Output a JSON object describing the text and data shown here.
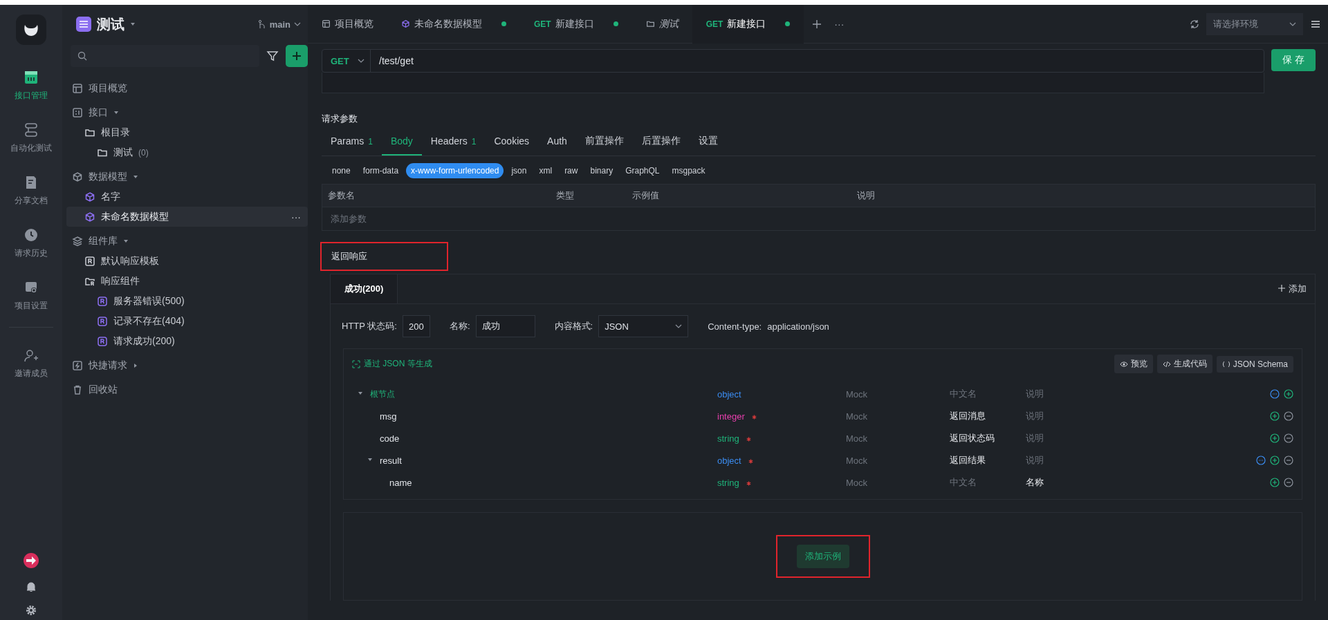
{
  "rail": {
    "items": [
      {
        "label": "接口管理",
        "kind": "api",
        "selected": true
      },
      {
        "label": "自动化测试",
        "kind": "auto",
        "selected": false
      },
      {
        "label": "分享文档",
        "kind": "doc",
        "selected": false
      },
      {
        "label": "请求历史",
        "kind": "history",
        "selected": false
      },
      {
        "label": "项目设置",
        "kind": "settings",
        "selected": false
      }
    ],
    "invite": "邀请成员"
  },
  "project": {
    "name": "测试",
    "branch": "main"
  },
  "sidebar": {
    "items": [
      {
        "label": "项目概览",
        "kind": "overview"
      },
      {
        "label": "接口",
        "kind": "api",
        "expanded": true,
        "children": [
          {
            "label": "根目录",
            "kind": "folder",
            "children": [
              {
                "label": "测试",
                "kind": "folder",
                "count": "(0)"
              }
            ]
          }
        ]
      },
      {
        "label": "数据模型",
        "kind": "model-group",
        "expanded": true,
        "children": [
          {
            "label": "名字",
            "kind": "model",
            "selected": false
          },
          {
            "label": "未命名数据模型",
            "kind": "model",
            "selected": true,
            "more": "···"
          }
        ]
      },
      {
        "label": "组件库",
        "kind": "layers",
        "expanded": true,
        "children": [
          {
            "label": "默认响应模板",
            "kind": "response"
          },
          {
            "label": "响应组件",
            "kind": "response-folder",
            "children": [
              {
                "label": "服务器错误(500)",
                "kind": "response-item"
              },
              {
                "label": "记录不存在(404)",
                "kind": "response-item"
              },
              {
                "label": "请求成功(200)",
                "kind": "response-item"
              }
            ]
          }
        ]
      },
      {
        "label": "快捷请求",
        "kind": "quick",
        "expanded": false
      },
      {
        "label": "回收站",
        "kind": "trash"
      }
    ]
  },
  "tabs": [
    {
      "label": "项目概览",
      "kind": "overview",
      "selected": false,
      "modified": false
    },
    {
      "label": "未命名数据模型",
      "kind": "model",
      "selected": false,
      "modified": true
    },
    {
      "method": "GET",
      "label": "新建接口",
      "kind": "api",
      "selected": false,
      "modified": true
    },
    {
      "label": "测试",
      "kind": "folder",
      "selected": false,
      "modified": false
    },
    {
      "method": "GET",
      "label": "新建接口",
      "kind": "api",
      "selected": true,
      "modified": true
    }
  ],
  "tab_more": "···",
  "environment": {
    "placeholder": "请选择环境"
  },
  "request": {
    "method": "GET",
    "url": "/test/get",
    "save": "保 存"
  },
  "params": {
    "title": "请求参数",
    "tabs": [
      {
        "label": "Params",
        "count": "1",
        "selected": false
      },
      {
        "label": "Body",
        "selected": true
      },
      {
        "label": "Headers",
        "count": "1",
        "selected": false
      },
      {
        "label": "Cookies",
        "selected": false
      },
      {
        "label": "Auth",
        "selected": false
      },
      {
        "label": "前置操作",
        "selected": false
      },
      {
        "label": "后置操作",
        "selected": false
      },
      {
        "label": "设置",
        "selected": false
      }
    ],
    "body_types": [
      {
        "label": "none",
        "selected": false
      },
      {
        "label": "form-data",
        "selected": false
      },
      {
        "label": "x-www-form-urlencoded",
        "selected": true
      },
      {
        "label": "json",
        "selected": false
      },
      {
        "label": "xml",
        "selected": false
      },
      {
        "label": "raw",
        "selected": false
      },
      {
        "label": "binary",
        "selected": false
      },
      {
        "label": "GraphQL",
        "selected": false
      },
      {
        "label": "msgpack",
        "selected": false
      }
    ],
    "columns": [
      "参数名",
      "类型",
      "示例值",
      "说明"
    ],
    "add_row": "添加参数"
  },
  "response": {
    "title": "返回响应",
    "highlighted": true,
    "tabs": [
      {
        "label": "成功(200)",
        "selected": true
      }
    ],
    "add": "添加",
    "status_label": "HTTP 状态码:",
    "status": "200",
    "name_label": "名称:",
    "name": "成功",
    "format_label": "内容格式:",
    "format": "JSON",
    "content_type_label": "Content-type:",
    "content_type": "application/json",
    "generate": "通过 JSON 等生成",
    "tools": [
      {
        "label": "预览",
        "kind": "preview"
      },
      {
        "label": "生成代码",
        "kind": "code"
      },
      {
        "label": "JSON Schema",
        "kind": "schema"
      }
    ],
    "tree": [
      {
        "name": "根节点",
        "root": true,
        "expanded": true,
        "type": "object",
        "color": "#3b8cf0",
        "required": false,
        "mock": "Mock",
        "title": {
          "placeholder": "中文名"
        },
        "description": {
          "placeholder": "说明"
        },
        "children": [
          {
            "name": "msg",
            "type": "integer",
            "color": "#e83fae",
            "required": true,
            "mock": "Mock",
            "title": {
              "value": "返回消息"
            },
            "description": {
              "placeholder": "说明"
            }
          },
          {
            "name": "code",
            "type": "string",
            "color": "#1fb47a",
            "required": true,
            "mock": "Mock",
            "title": {
              "value": "返回状态码"
            },
            "description": {
              "placeholder": "说明"
            }
          },
          {
            "name": "result",
            "expanded": true,
            "type": "object",
            "color": "#3b8cf0",
            "required": true,
            "mock": "Mock",
            "title": {
              "value": "返回结果"
            },
            "description": {
              "placeholder": "说明"
            },
            "children": [
              {
                "name": "name",
                "type": "string",
                "color": "#1fb47a",
                "required": true,
                "mock": "Mock",
                "title": {
                  "placeholder": "中文名"
                },
                "description": {
                  "value": "名称"
                }
              }
            ]
          }
        ]
      }
    ],
    "add_example": "添加示例",
    "add_example_highlighted": true
  }
}
